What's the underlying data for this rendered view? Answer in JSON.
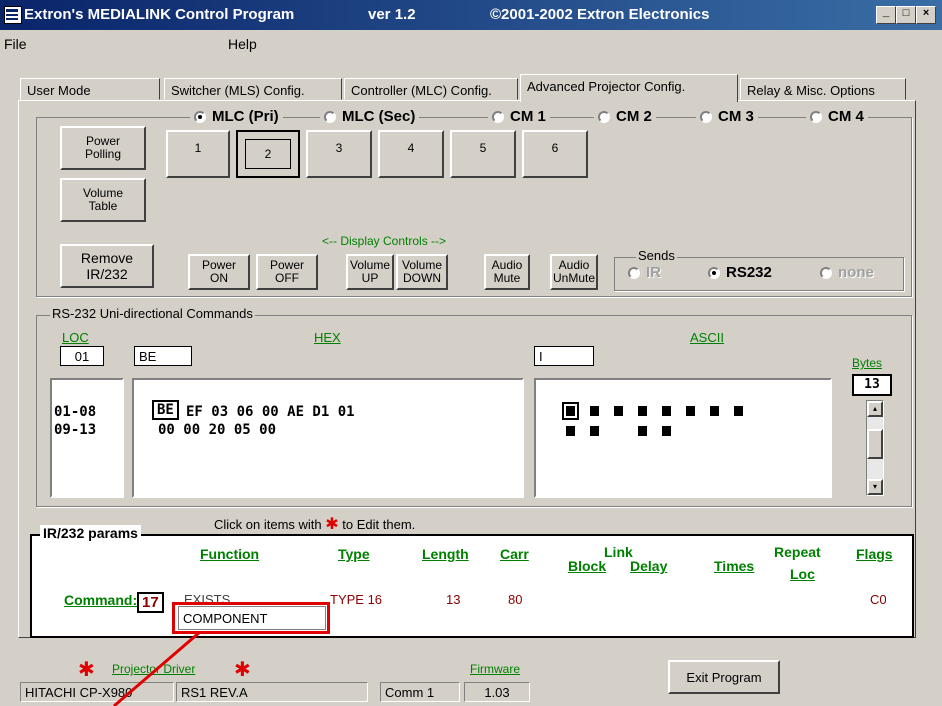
{
  "window": {
    "title_app": "Extron's MEDIALINK Control Program",
    "title_version": "ver 1.2",
    "title_copyright": "©2001-2002 Extron Electronics",
    "controls": [
      "_",
      "□",
      "×"
    ]
  },
  "menu": {
    "file": "File",
    "help": "Help"
  },
  "tabs": [
    {
      "label": "User Mode"
    },
    {
      "label": "Switcher (MLS) Config."
    },
    {
      "label": "Controller (MLC) Config."
    },
    {
      "label": "Advanced Projector Config.",
      "active": true
    },
    {
      "label": "Relay & Misc. Options"
    }
  ],
  "ports": {
    "options": [
      "MLC (Pri)",
      "MLC (Sec)",
      "CM 1",
      "CM 2",
      "CM 3",
      "CM 4"
    ],
    "selected": "MLC (Pri)"
  },
  "side_buttons": {
    "power_polling": "Power\nPolling",
    "volume_table": "Volume\nTable",
    "remove": "Remove\nIR/232"
  },
  "slots": {
    "labels": [
      "1",
      "2",
      "3",
      "4",
      "5",
      "6"
    ],
    "selected": "2"
  },
  "display_controls": {
    "caption": "<-- Display Controls -->",
    "buttons": [
      "Power\nON",
      "Power\nOFF",
      "Volume\nUP",
      "Volume\nDOWN",
      "Audio\nMute",
      "Audio\nUnMute"
    ]
  },
  "sends": {
    "label": "Sends",
    "options": [
      "IR",
      "RS232",
      "none"
    ],
    "selected": "RS232"
  },
  "rs232": {
    "group_label": "RS-232 Uni-directional Commands",
    "loc_label": "LOC",
    "hex_label": "HEX",
    "ascii_label": "ASCII",
    "bytes_label": "Bytes",
    "loc_value": "01",
    "hex_value": "BE",
    "ascii_value": "I",
    "bytes_value": "13",
    "rows": [
      {
        "range": "01-08",
        "first": "BE",
        "hex": "EF 03 06 00 AE D1 01"
      },
      {
        "range": "09-13",
        "first": "",
        "hex": "00 00 20 05 00"
      }
    ],
    "ascii_row1": 8,
    "ascii_row2": 4
  },
  "edit_hint": {
    "before": "Click on items with",
    "after": "to Edit them."
  },
  "params": {
    "group_label": "IR/232 params",
    "headers": {
      "function": "Function",
      "type": "Type",
      "length": "Length",
      "carr": "Carr",
      "link": "Link",
      "block": "Block",
      "delay": "Delay",
      "repeat": "Repeat",
      "times": "Times",
      "loc": "Loc",
      "flags": "Flags"
    },
    "command_label": "Command:",
    "command_number": "17",
    "function_value": "EXISTS",
    "type_value": "TYPE 16",
    "length_value": "13",
    "carr_value": "80",
    "flags_value": "C0",
    "name_field": "COMPONENT"
  },
  "status": {
    "projector_driver_label": "Projector Driver",
    "firmware_label": "Firmware",
    "projector": "HITACHI CP-X980",
    "driver": "RS1 REV.A",
    "comm": "Comm 1",
    "firmware": "1.03",
    "exit_button": "Exit Program"
  },
  "colors": {
    "title_bar": "#0a246a",
    "face": "#d4d0c8",
    "accent_green": "#008000",
    "star_red": "#e00000",
    "callout_red": "#e00000"
  }
}
